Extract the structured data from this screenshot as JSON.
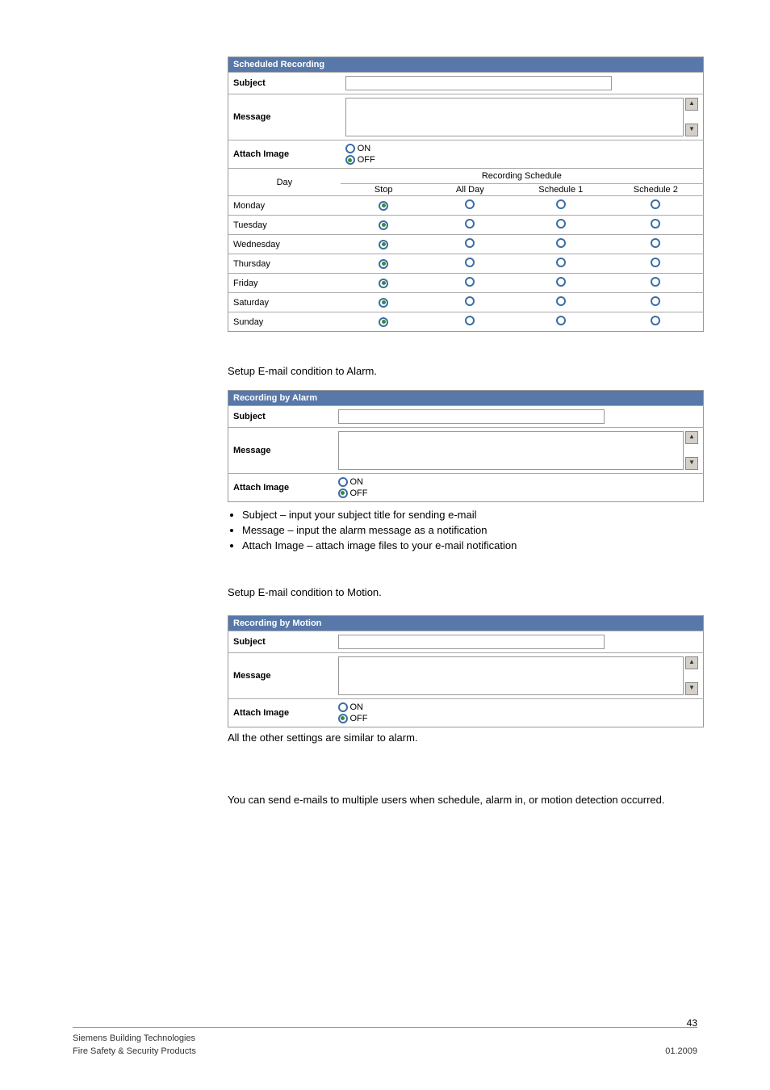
{
  "scheduled": {
    "header": "Scheduled Recording",
    "subject_label": "Subject",
    "message_label": "Message",
    "attach_label": "Attach Image",
    "on": "ON",
    "off": "OFF",
    "day_label": "Day",
    "rec_sched_label": "Recording Schedule",
    "cols": {
      "stop": "Stop",
      "allday": "All Day",
      "s1": "Schedule 1",
      "s2": "Schedule 2"
    },
    "days": [
      "Monday",
      "Tuesday",
      "Wednesday",
      "Thursday",
      "Friday",
      "Saturday",
      "Sunday"
    ]
  },
  "text": {
    "alarm_setup": "Setup E-mail condition to Alarm.",
    "motion_setup": "Setup E-mail condition to Motion.",
    "allsimilar": "All the other settings are similar to alarm.",
    "multiusers": "You can send e-mails to multiple users when schedule, alarm in, or motion detection occurred."
  },
  "alarm": {
    "header": "Recording by Alarm",
    "subject_label": "Subject",
    "message_label": "Message",
    "attach_label": "Attach Image",
    "on": "ON",
    "off": "OFF"
  },
  "bullets": {
    "b1": "Subject – input your subject title for sending e-mail",
    "b2": "Message – input the alarm message as a notification",
    "b3": "Attach Image – attach image files to your e-mail notification"
  },
  "motion": {
    "header": "Recording by Motion",
    "subject_label": "Subject",
    "message_label": "Message",
    "attach_label": "Attach Image",
    "on": "ON",
    "off": "OFF"
  },
  "footer": {
    "l1": "Siemens Building Technologies",
    "l2": "Fire Safety & Security Products",
    "date": "01.2009",
    "page": "43"
  }
}
